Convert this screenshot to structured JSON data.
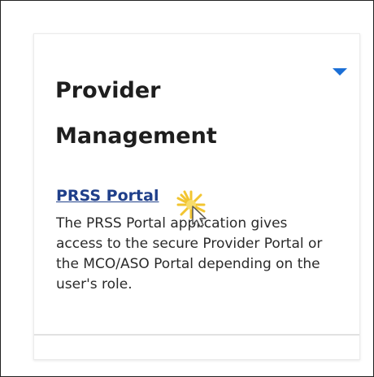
{
  "card": {
    "title": "Provider Management",
    "link_label": "PRSS Portal",
    "description": "The PRSS Portal application gives access to the secure Provider Portal or the MCO/ASO Portal depending on the user's role."
  },
  "icons": {
    "expand": "chevron-down-icon",
    "cursor": "mouse-pointer-icon"
  },
  "colors": {
    "link": "#1f3f8a",
    "caret": "#1b6fd6",
    "title": "#1e1e1e",
    "click_highlight": "#f2c531"
  }
}
